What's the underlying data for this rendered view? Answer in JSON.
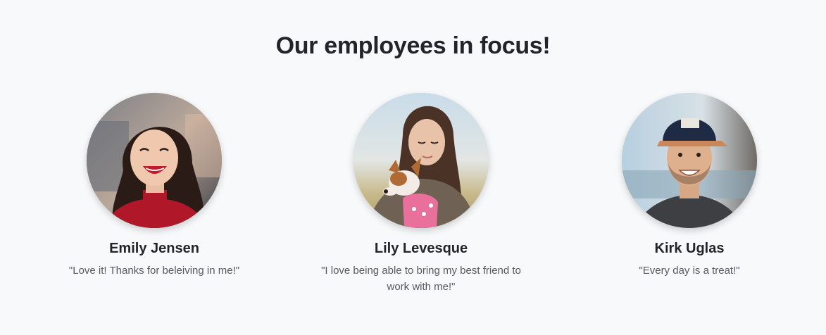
{
  "section": {
    "title": "Our employees in focus!"
  },
  "employees": [
    {
      "name": "Emily Jensen",
      "quote": "\"Love it! Thanks for beleiving in me!\""
    },
    {
      "name": "Lily Levesque",
      "quote": "\"I love being able to bring my best friend to work with me!\""
    },
    {
      "name": "Kirk Uglas",
      "quote": "\"Every day is a treat!\""
    }
  ]
}
